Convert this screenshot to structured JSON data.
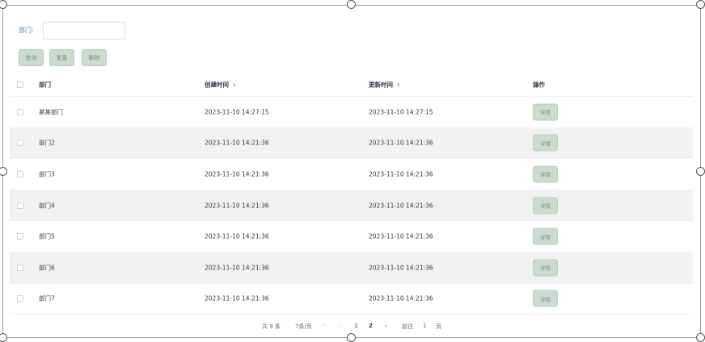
{
  "filter": {
    "label": "部门:",
    "value": "",
    "placeholder": ""
  },
  "buttons": {
    "query": "查询",
    "reset": "重置",
    "delete": "删除"
  },
  "columns": {
    "dept": "部门",
    "created": "创建时间",
    "updated": "更新时间",
    "action": "操作",
    "sort_glyph": "⇕"
  },
  "rows": [
    {
      "dept": "某某部门",
      "created": "2023-11-10 14:27:15",
      "updated": "2023-11-10 14:27:15",
      "action": "详情"
    },
    {
      "dept": "部门2",
      "created": "2023-11-10 14:21:36",
      "updated": "2023-11-10 14:21:36",
      "action": "详情"
    },
    {
      "dept": "部门3",
      "created": "2023-11-10 14:21:36",
      "updated": "2023-11-10 14:21:36",
      "action": "详情"
    },
    {
      "dept": "部门4",
      "created": "2023-11-10 14:21:36",
      "updated": "2023-11-10 14:21:36",
      "action": "详情"
    },
    {
      "dept": "部门5",
      "created": "2023-11-10 14:21:36",
      "updated": "2023-11-10 14:21:36",
      "action": "详情"
    },
    {
      "dept": "部门6",
      "created": "2023-11-10 14:21:36",
      "updated": "2023-11-10 14:21:36",
      "action": "详情"
    },
    {
      "dept": "部门7",
      "created": "2023-11-10 14:21:36",
      "updated": "2023-11-10 14:21:36",
      "action": "详情"
    }
  ],
  "pagination": {
    "total": "共 9 条",
    "page_size": "7条/页",
    "size_caret": "⌄",
    "prev": "‹",
    "page1": "1",
    "page2": "2",
    "next": "›",
    "goto_label": "前往",
    "goto_value": "1",
    "page_suffix": "页"
  },
  "colors": {
    "accent": "#3a8ec4",
    "button_bg": "#c9dccd",
    "stripe": "#f2f2f2"
  }
}
